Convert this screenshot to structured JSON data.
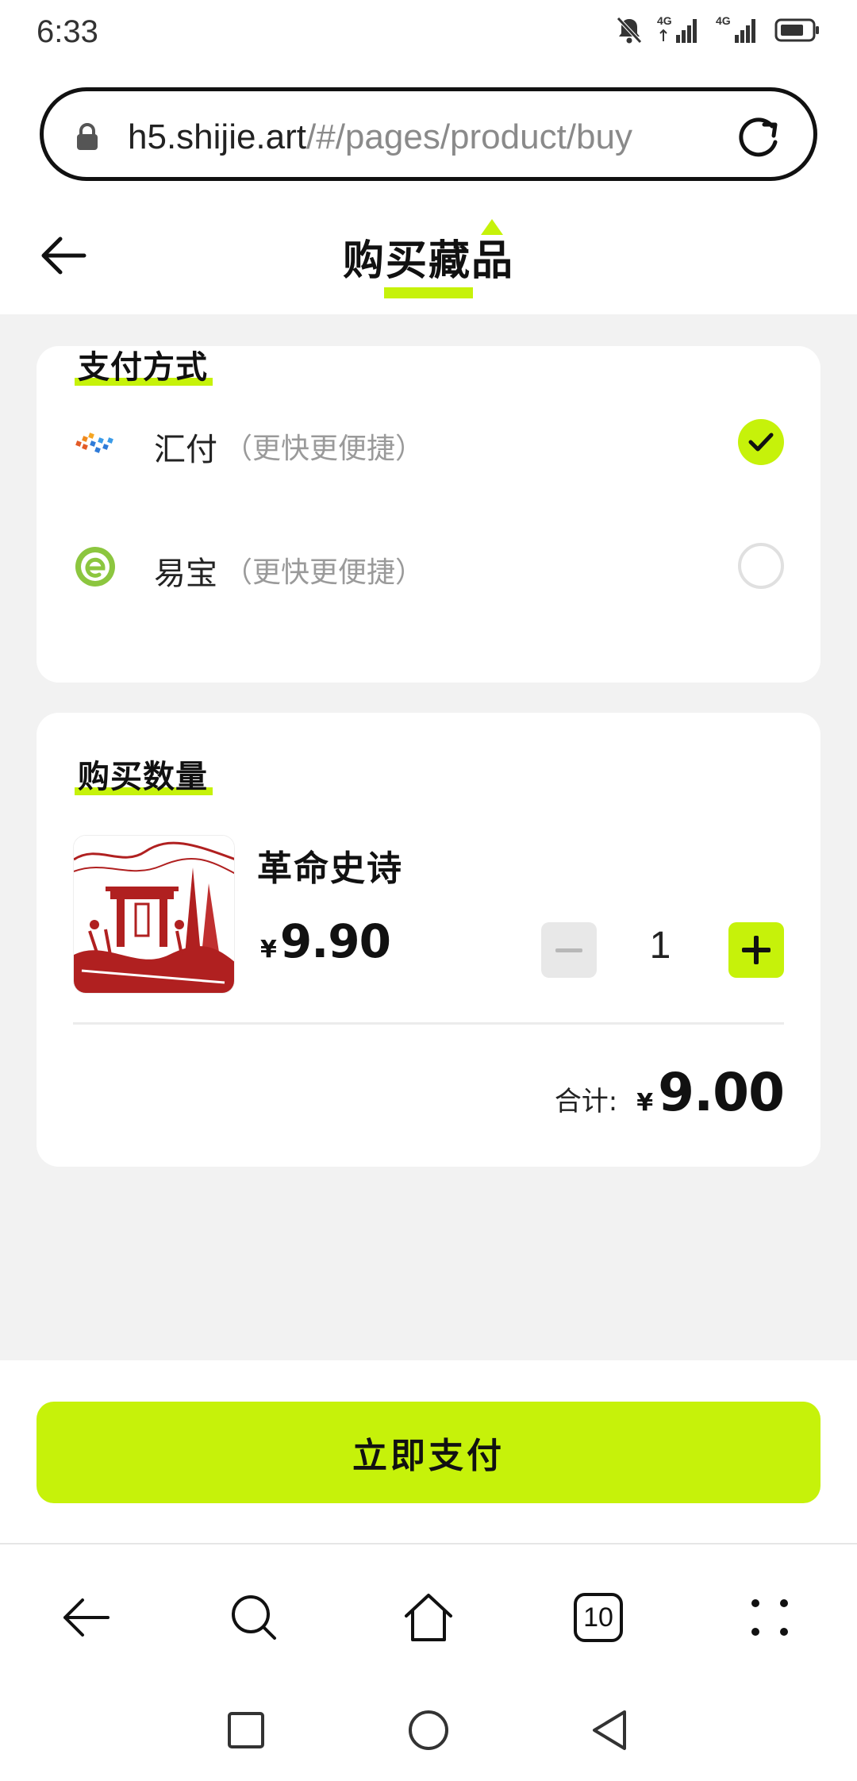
{
  "status_bar": {
    "time": "6:33",
    "network_1": "4G",
    "network_2": "4G",
    "icons": [
      "bell-off-icon",
      "signal-icon",
      "signal-icon",
      "battery-icon"
    ]
  },
  "browser": {
    "url_host": "h5.shijie.art",
    "url_path": "/#/pages/product/buy",
    "tab_count": "10",
    "nav_icons": [
      "back-arrow-icon",
      "search-icon",
      "home-icon",
      "tabs-icon",
      "more-icon"
    ]
  },
  "header": {
    "title": "购买藏品"
  },
  "payment": {
    "section_title": "支付方式",
    "methods": [
      {
        "name": "汇付",
        "note": "（更快更便捷）",
        "selected": true
      },
      {
        "name": "易宝",
        "note": "（更快更便捷）",
        "selected": false
      }
    ]
  },
  "quantity": {
    "section_title": "购买数量",
    "product_name": "革命史诗",
    "currency": "¥",
    "unit_price": "9.90",
    "qty": "1",
    "total_label": "合计:",
    "total_value": "9.00"
  },
  "actions": {
    "pay_now": "立即支付"
  },
  "colors": {
    "accent": "#c6f20a",
    "background": "#f2f2f2",
    "muted_text": "#9a9a9a"
  }
}
